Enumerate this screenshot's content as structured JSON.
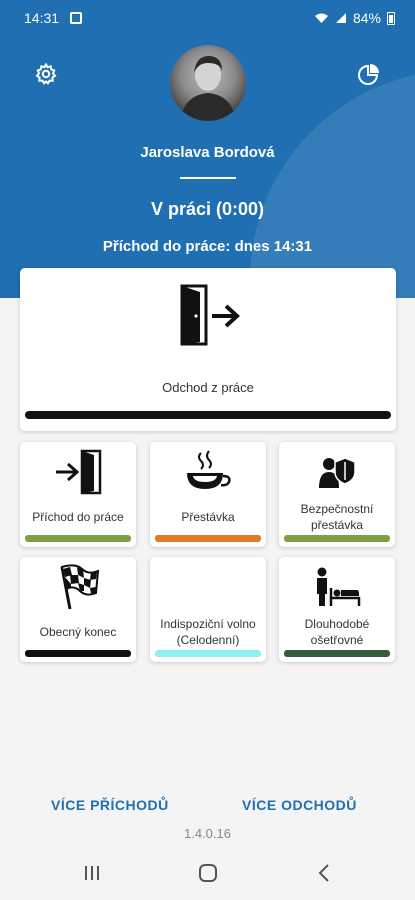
{
  "status_bar": {
    "time": "14:31",
    "battery": "84%"
  },
  "header": {
    "user_name": "Jaroslava Bordová",
    "state": "V práci (0:00)",
    "arrival": "Příchod do práce: dnes 14:31"
  },
  "main_action": {
    "label": "Odchod z práce",
    "bar_color": "#111111"
  },
  "tiles": [
    {
      "label": "Příchod do práce",
      "icon": "enter-door-icon",
      "bar_color": "#7ea043"
    },
    {
      "label": "Přestávka",
      "icon": "coffee-cup-icon",
      "bar_color": "#e07a26"
    },
    {
      "label": "Bezpečnostní přestávka",
      "icon": "security-person-icon",
      "bar_color": "#7ea043"
    },
    {
      "label": "Obecný konec",
      "icon": "checkered-flag-icon",
      "bar_color": "#111111"
    },
    {
      "label": "Indispoziční volno (Celodenní)",
      "icon": "",
      "bar_color": "#8ff0f0"
    },
    {
      "label": "Dlouhodobé ošetřovné",
      "icon": "caregiver-bed-icon",
      "bar_color": "#365c3a"
    }
  ],
  "links": {
    "more_arrivals": "VÍCE PŘÍCHODŮ",
    "more_departures": "VÍCE ODCHODŮ"
  },
  "version": "1.4.0.16",
  "colors": {
    "header": "#1f6fb2",
    "link": "#1f6fb2"
  }
}
